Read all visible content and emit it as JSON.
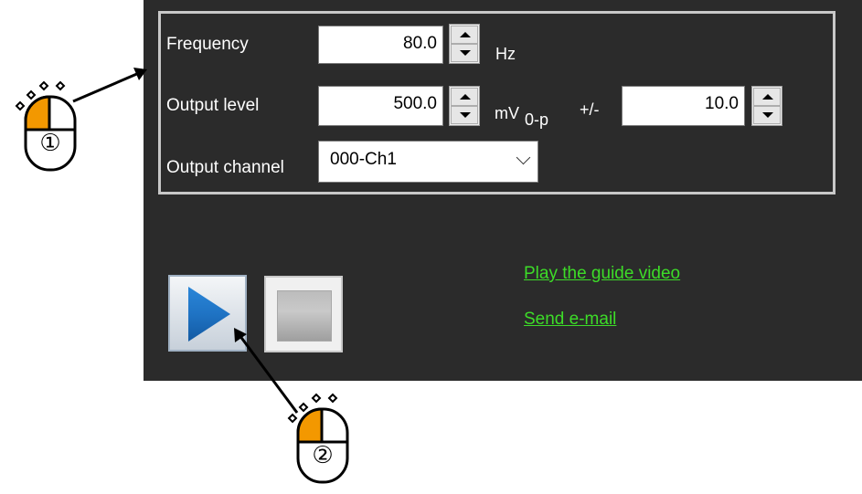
{
  "form": {
    "frequency": {
      "label": "Frequency",
      "value": "80.0",
      "unit": "Hz"
    },
    "output_level": {
      "label": "Output level",
      "value": "500.0",
      "unit_main": "mV",
      "unit_sub": "0-p",
      "tolerance_label": "+/-",
      "tolerance_value": "10.0"
    },
    "output_channel": {
      "label": "Output channel",
      "selected": "000-Ch1"
    }
  },
  "links": {
    "guide_video": "Play the guide video",
    "send_email": "Send e-mail"
  },
  "annotations": {
    "step1": "①",
    "step2": "②",
    "mouse_body_color": "#ffffff",
    "mouse_button_color": "#f39800",
    "outline_color": "#000000"
  },
  "colors": {
    "panel_bg": "#2b2b2b",
    "link": "#3ddc28",
    "play_blue": "#1a6fc0"
  }
}
